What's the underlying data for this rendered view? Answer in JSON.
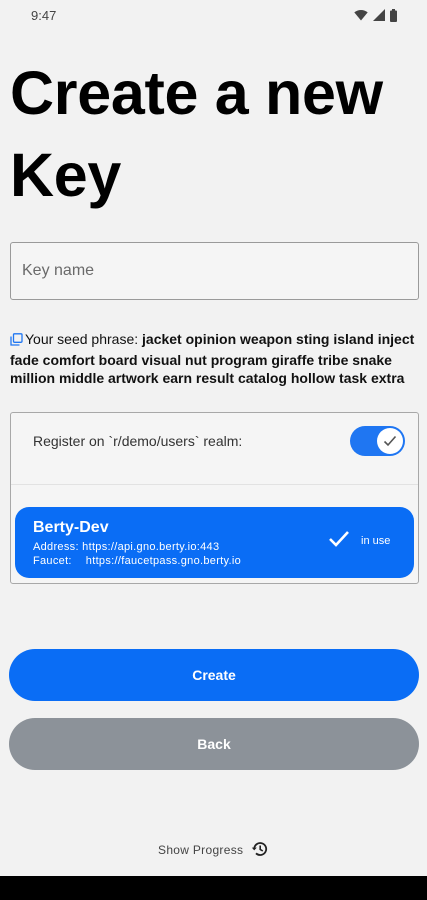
{
  "status_bar": {
    "time": "9:47",
    "icons": [
      "wifi-icon",
      "signal-icon",
      "battery-icon"
    ]
  },
  "title": "Create a new Key",
  "key_name_input": {
    "placeholder": "Key name",
    "value": ""
  },
  "seed": {
    "copy_icon": "copy-icon",
    "label": "Your seed phrase:",
    "phrase": "jacket opinion weapon sting island inject fade comfort board visual nut program giraffe tribe snake million middle artwork earn result catalog hollow task extra"
  },
  "register": {
    "label": "Register on `r/demo/users` realm:",
    "enabled": true
  },
  "network": {
    "name": "Berty-Dev",
    "address_label": "Address:",
    "address": "https://api.gno.berty.io:443",
    "faucet_label": "Faucet:",
    "faucet": "https://faucetpass.gno.berty.io",
    "status": "in use",
    "selected": true
  },
  "buttons": {
    "create": "Create",
    "back": "Back"
  },
  "show_progress": "Show Progress",
  "colors": {
    "primary": "#0a6df5",
    "back_button": "#8c9299",
    "background": "#f2f2f2"
  }
}
